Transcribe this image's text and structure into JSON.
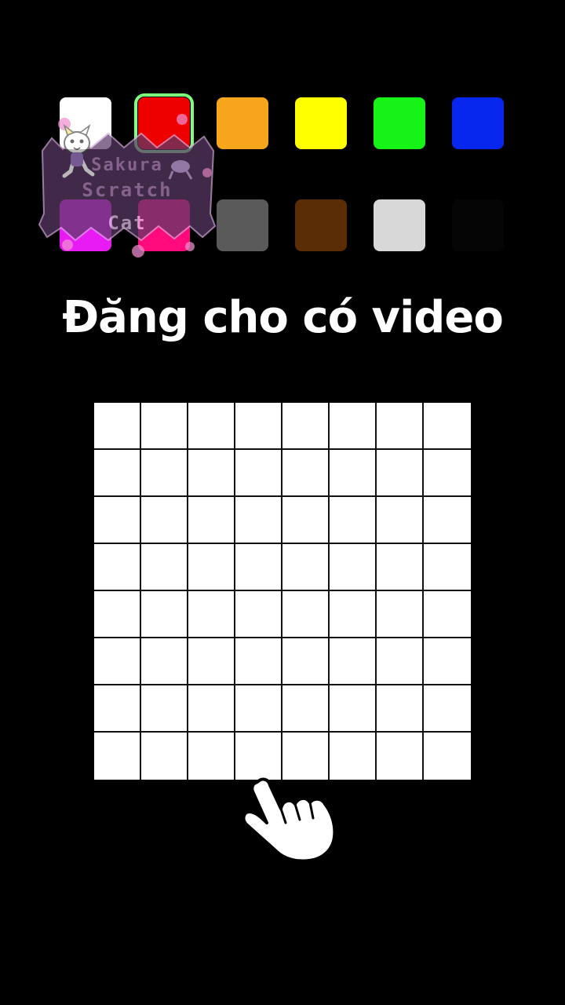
{
  "title": "Đăng cho có video",
  "palette": {
    "selected_index": 1,
    "rows": [
      [
        {
          "name": "white",
          "color": "#FFFFFF"
        },
        {
          "name": "red",
          "color": "#EE0000"
        },
        {
          "name": "orange",
          "color": "#F7A61B"
        },
        {
          "name": "yellow",
          "color": "#FFFF00"
        },
        {
          "name": "green",
          "color": "#16F316"
        },
        {
          "name": "blue",
          "color": "#0726EE"
        }
      ],
      [
        {
          "name": "magenta",
          "color": "#E91BF5"
        },
        {
          "name": "pink",
          "color": "#FF0A7C"
        },
        {
          "name": "gray",
          "color": "#5A5A5A"
        },
        {
          "name": "brown",
          "color": "#5A2D04"
        },
        {
          "name": "light-gray",
          "color": "#D8D8D8"
        },
        {
          "name": "black",
          "color": "#050505"
        }
      ]
    ]
  },
  "sticker": {
    "lines": [
      "Sakura",
      "Scratch",
      "Cat"
    ]
  },
  "board": {
    "rows": 8,
    "cols": 8,
    "cell_color": "#FFFFFF",
    "line_color": "#111111"
  },
  "cursor": {
    "icon": "pointing-hand-icon"
  }
}
